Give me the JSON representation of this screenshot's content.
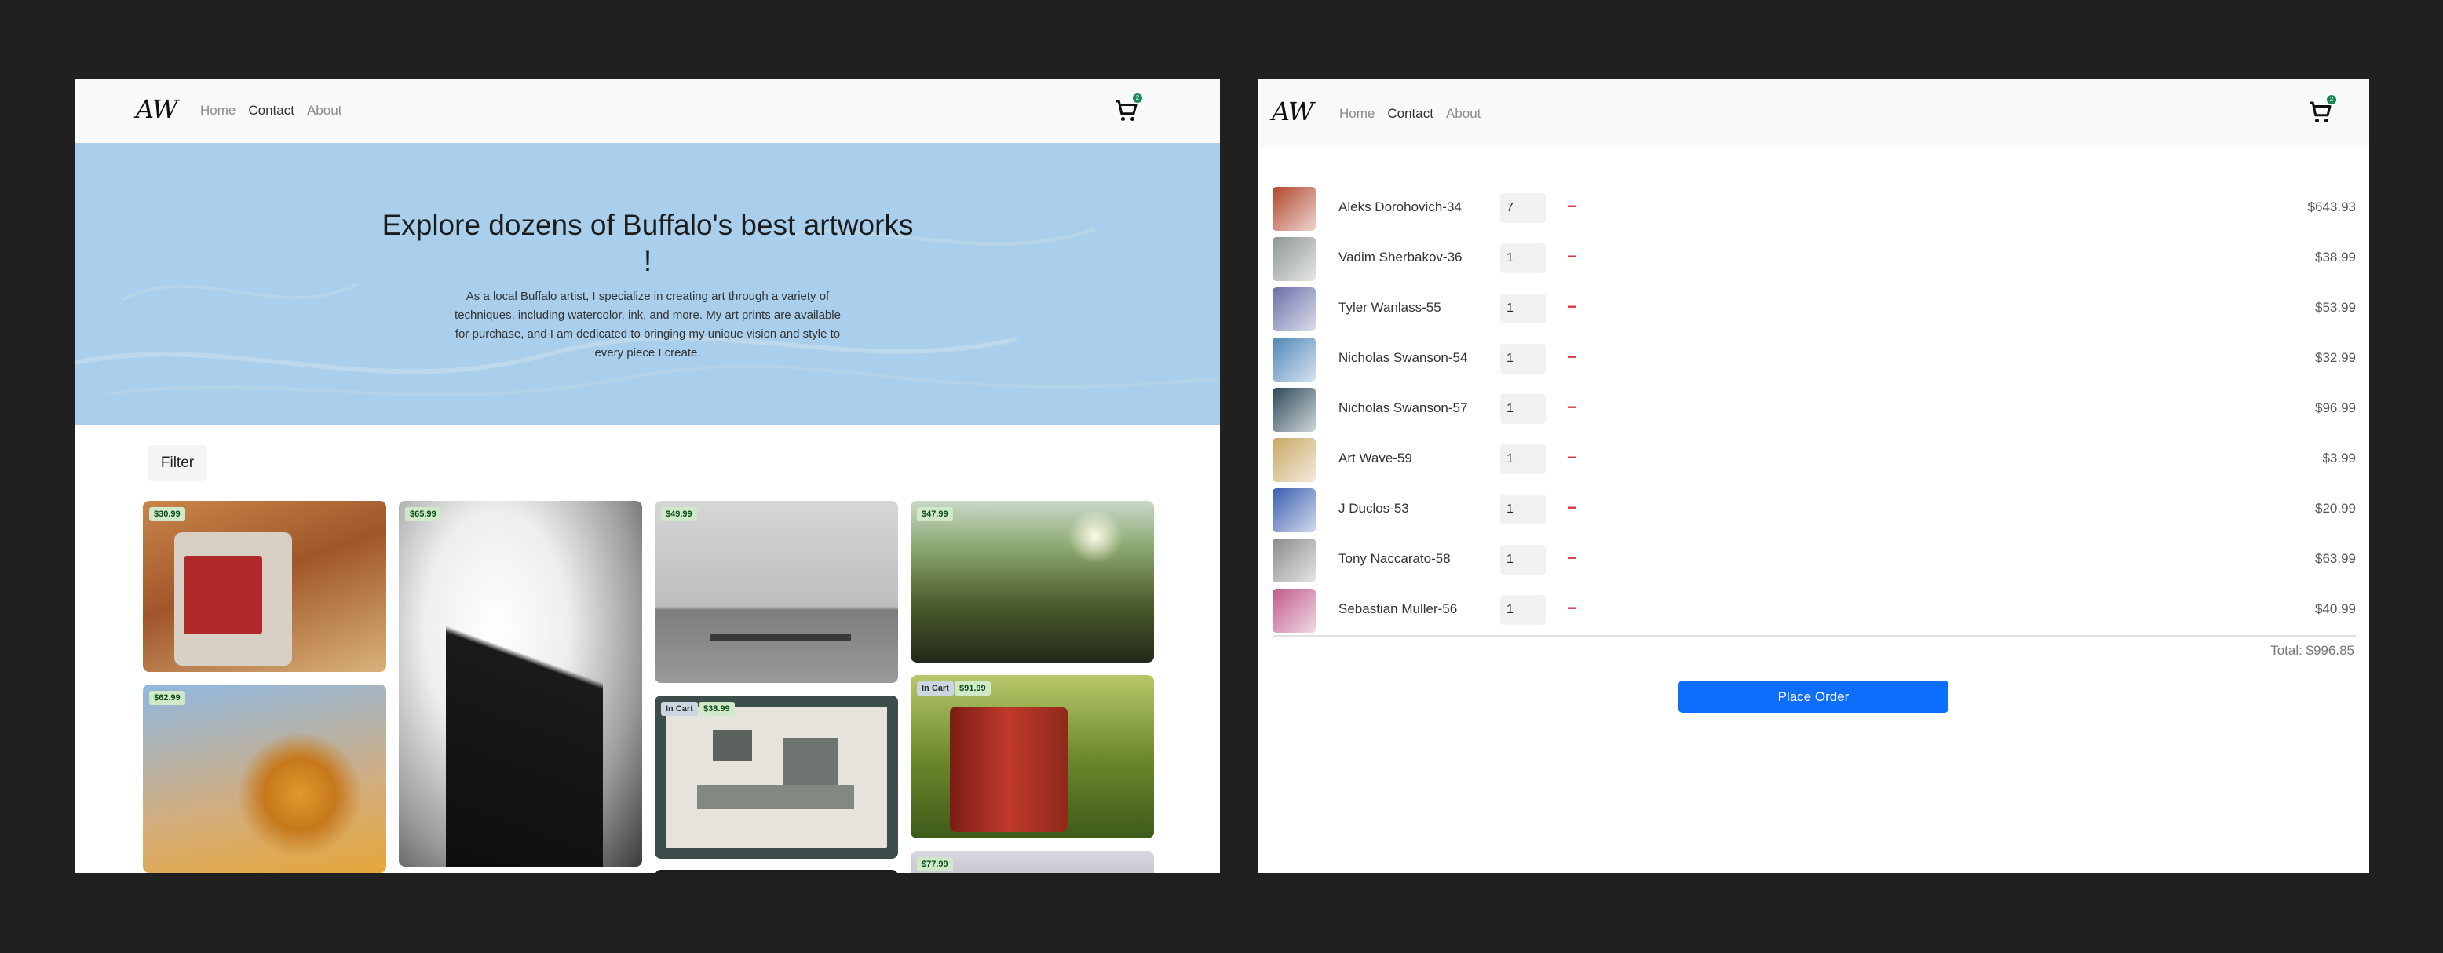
{
  "brand": "AW",
  "nav": {
    "home": "Home",
    "contact": "Contact",
    "about": "About"
  },
  "cart_count": "2",
  "hero": {
    "title": "Explore dozens of Buffalo's best artworks !",
    "description": "As a local Buffalo artist, I specialize in creating art through a variety of techniques, including watercolor, ink, and more. My art prints are available for purchase, and I am dedicated to bringing my unique vision and style to every piece I create."
  },
  "filter_label": "Filter",
  "in_cart_label": "In Cart",
  "gallery": [
    {
      "price": "$30.99",
      "in_cart": false,
      "subject": "vintage mug"
    },
    {
      "price": "$62.99",
      "in_cart": false,
      "subject": "cactus close-up"
    },
    {
      "price": "$65.99",
      "in_cart": false,
      "subject": "bare feet black and white"
    },
    {
      "price": "$49.99",
      "in_cart": false,
      "subject": "bench by wall"
    },
    {
      "price": "$38.99",
      "in_cart": true,
      "subject": "flat lay of gadgets"
    },
    {
      "price": "$47.99",
      "in_cart": false,
      "subject": "sunset over grass"
    },
    {
      "price": "$91.99",
      "in_cart": true,
      "subject": "red barrel in grass"
    },
    {
      "price": "$77.99",
      "in_cart": false,
      "subject": "abstract"
    }
  ],
  "cart_items": [
    {
      "name": "Aleks Dorohovich-34",
      "qty": "7",
      "price": "$643.93",
      "thumb": "#b2462c"
    },
    {
      "name": "Vadim Sherbakov-36",
      "qty": "1",
      "price": "$38.99",
      "thumb": "#8e9694"
    },
    {
      "name": "Tyler Wanlass-55",
      "qty": "1",
      "price": "$53.99",
      "thumb": "#6a6fa8"
    },
    {
      "name": "Nicholas Swanson-54",
      "qty": "1",
      "price": "$32.99",
      "thumb": "#4f86b8"
    },
    {
      "name": "Nicholas Swanson-57",
      "qty": "1",
      "price": "$96.99",
      "thumb": "#2d4a5a"
    },
    {
      "name": "Art Wave-59",
      "qty": "1",
      "price": "$3.99",
      "thumb": "#c9a865"
    },
    {
      "name": "J Duclos-53",
      "qty": "1",
      "price": "$20.99",
      "thumb": "#3a5fb0"
    },
    {
      "name": "Tony Naccarato-58",
      "qty": "1",
      "price": "$63.99",
      "thumb": "#8c8c8c"
    },
    {
      "name": "Sebastian Muller-56",
      "qty": "1",
      "price": "$40.99",
      "thumb": "#c05a8a"
    }
  ],
  "remove_symbol": "−",
  "total_label": "Total: $996.85",
  "place_order_label": "Place Order",
  "colors": {
    "accent": "#0d6efd",
    "hero_bg": "#a9cfec",
    "remove": "#dc3545",
    "badge": "#cfe9c9"
  }
}
